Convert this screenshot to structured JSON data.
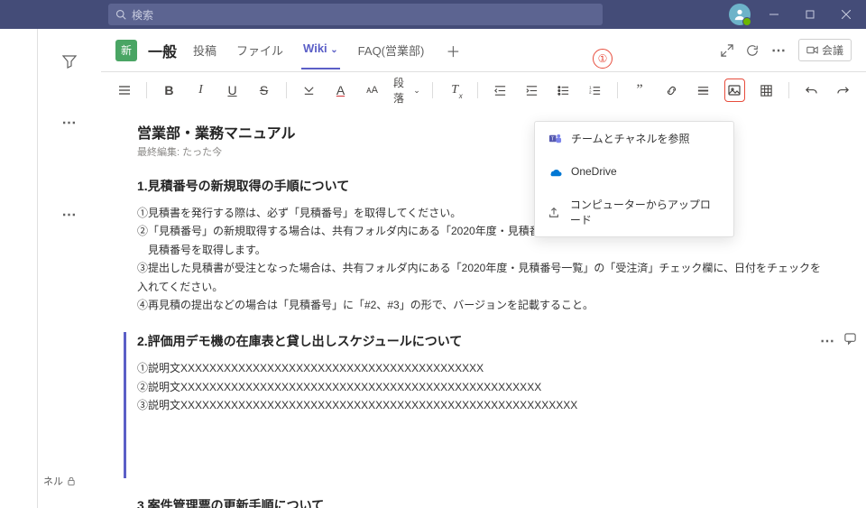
{
  "titlebar": {
    "search_placeholder": "検索"
  },
  "left_panel": {
    "bottom_label": "ネル"
  },
  "header": {
    "team_badge": "新",
    "channel_name": "一般",
    "tabs": [
      "投稿",
      "ファイル",
      "Wiki",
      "FAQ(営業部)"
    ],
    "active_tab_index": 2,
    "meet_label": "会議"
  },
  "callout": {
    "number": "①"
  },
  "toolbar": {
    "paragraph_label": "段落"
  },
  "dropdown": {
    "items": [
      {
        "label": "チームとチャネルを参照"
      },
      {
        "label": "OneDrive"
      },
      {
        "label": "コンピューターからアップロード"
      }
    ]
  },
  "page": {
    "title": "営業部・業務マニュアル",
    "subtitle": "最終編集: たった今",
    "sections": [
      {
        "title": "1.見積番号の新規取得の手順について",
        "lines": [
          "①見積書を発行する際は、必ず「見積番号」を取得してください。",
          "②「見積番号」の新規取得する場合は、共有フォルダ内にある「2020年度・見積番号一覧」に必要事項を記入の上",
          "　見積番号を取得します。",
          "③提出した見積書が受注となった場合は、共有フォルダ内にある「2020年度・見積番号一覧」の「受注済」チェック欄に、日付をチェックを入れてください。",
          "④再見積の提出などの場合は「見積番号」に「#2、#3」の形で、バージョンを記載すること。"
        ]
      },
      {
        "title": "2.評価用デモ機の在庫表と貸し出しスケジュールについて",
        "lines": [
          "①説明文XXXXXXXXXXXXXXXXXXXXXXXXXXXXXXXXXXXXXXXXXX",
          "②説明文XXXXXXXXXXXXXXXXXXXXXXXXXXXXXXXXXXXXXXXXXXXXXXXXXX",
          "③説明文XXXXXXXXXXXXXXXXXXXXXXXXXXXXXXXXXXXXXXXXXXXXXXXXXXXXXXX"
        ]
      },
      {
        "title": "3.案件管理票の更新手順について",
        "lines": []
      }
    ]
  }
}
